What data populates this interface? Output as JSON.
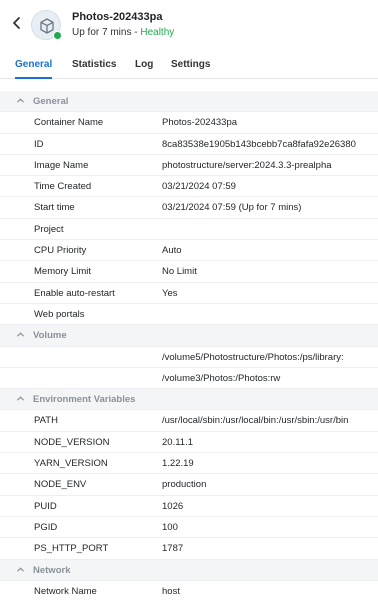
{
  "header": {
    "back_icon": "chevron-left-icon",
    "app_icon": "container-cube-icon",
    "title": "Photos-202433pa",
    "uptime": "Up for 7 mins - ",
    "health": "Healthy"
  },
  "tabs": [
    {
      "label": "General"
    },
    {
      "label": "Statistics"
    },
    {
      "label": "Log"
    },
    {
      "label": "Settings"
    }
  ],
  "rows": [
    {
      "type": "section",
      "label": "General"
    },
    {
      "type": "row",
      "key": "Container Name",
      "value": "Photos-202433pa"
    },
    {
      "type": "row",
      "key": "ID",
      "value": "8ca83538e1905b143bcebb7ca8fafa92e26380"
    },
    {
      "type": "row",
      "key": "Image Name",
      "value": "photostructure/server:2024.3.3-prealpha"
    },
    {
      "type": "row",
      "key": "Time Created",
      "value": "03/21/2024 07:59"
    },
    {
      "type": "row",
      "key": "Start time",
      "value": "03/21/2024 07:59 (Up for 7 mins)"
    },
    {
      "type": "row",
      "key": "Project",
      "value": ""
    },
    {
      "type": "row",
      "key": "CPU Priority",
      "value": "Auto"
    },
    {
      "type": "row",
      "key": "Memory Limit",
      "value": "No Limit"
    },
    {
      "type": "row",
      "key": "Enable auto-restart",
      "value": "Yes"
    },
    {
      "type": "row",
      "key": "Web portals",
      "value": ""
    },
    {
      "type": "section",
      "label": "Volume"
    },
    {
      "type": "row",
      "key": "",
      "value": "/volume5/Photostructure/Photos:/ps/library:"
    },
    {
      "type": "row",
      "key": "",
      "value": "/volume3/Photos:/Photos:rw"
    },
    {
      "type": "section",
      "label": "Environment Variables"
    },
    {
      "type": "row",
      "key": "PATH",
      "value": "/usr/local/sbin:/usr/local/bin:/usr/sbin:/usr/bin"
    },
    {
      "type": "row",
      "key": "NODE_VERSION",
      "value": "20.11.1"
    },
    {
      "type": "row",
      "key": "YARN_VERSION",
      "value": "1.22.19"
    },
    {
      "type": "row",
      "key": "NODE_ENV",
      "value": "production"
    },
    {
      "type": "row",
      "key": "PUID",
      "value": "1026"
    },
    {
      "type": "row",
      "key": "PGID",
      "value": "100"
    },
    {
      "type": "row",
      "key": "PS_HTTP_PORT",
      "value": "1787"
    },
    {
      "type": "section",
      "label": "Network"
    },
    {
      "type": "row",
      "key": "Network Name",
      "value": "host"
    }
  ],
  "colors": {
    "accent": "#1874d0",
    "healthy": "#22a952",
    "section_bg": "#f3f5f7",
    "section_text": "#8a9199"
  }
}
